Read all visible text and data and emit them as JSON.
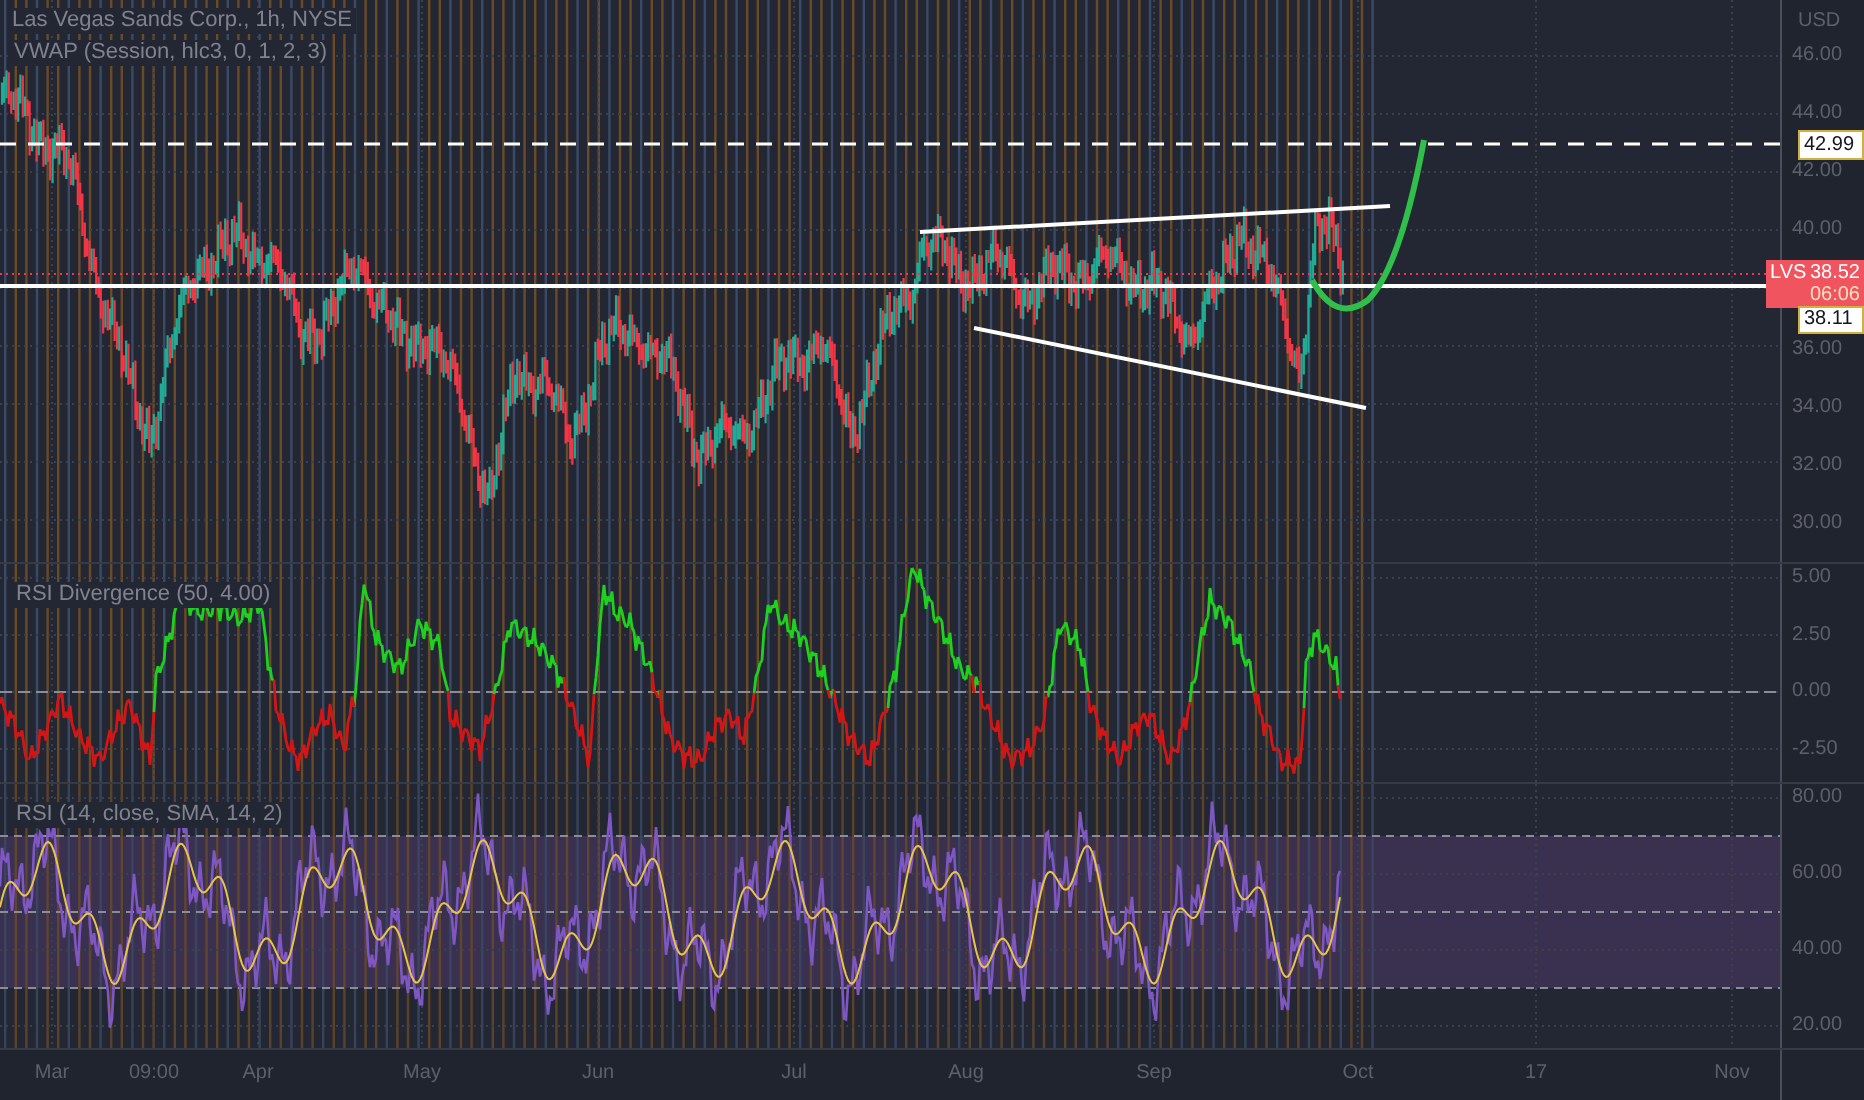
{
  "main_pane": {
    "symbol_legend": "Las Vegas Sands Corp., 1h, NYSE",
    "vwap_legend": "VWAP (Session, hlc3, 0, 1, 2, 3)"
  },
  "price_axis": {
    "currency": "USD",
    "ticks_upper": [
      "46.00",
      "44.00",
      "42.00",
      "40.00"
    ],
    "ticks_lower": [
      "36.00",
      "34.00",
      "32.00",
      "30.00"
    ]
  },
  "price_labels": [
    {
      "kind": "target",
      "text": "42.99"
    },
    {
      "kind": "last",
      "symbol": "LVS",
      "price": "38.52",
      "countdown": "06:06"
    },
    {
      "kind": "line",
      "text": "38.11"
    }
  ],
  "divergence_pane": {
    "legend": "RSI Divergence (50, 4.00)",
    "ticks": [
      "5.00",
      "2.50",
      "0.00",
      "-2.50"
    ]
  },
  "rsi_pane": {
    "legend": "RSI (14, close, SMA, 14, 2)",
    "ticks": [
      "80.00",
      "60.00",
      "40.00",
      "20.00"
    ]
  },
  "time_axis": [
    "Mar",
    "09:00",
    "Apr",
    "May",
    "Jun",
    "Jul",
    "Aug",
    "Sep",
    "Oct",
    "17",
    "Nov"
  ]
}
